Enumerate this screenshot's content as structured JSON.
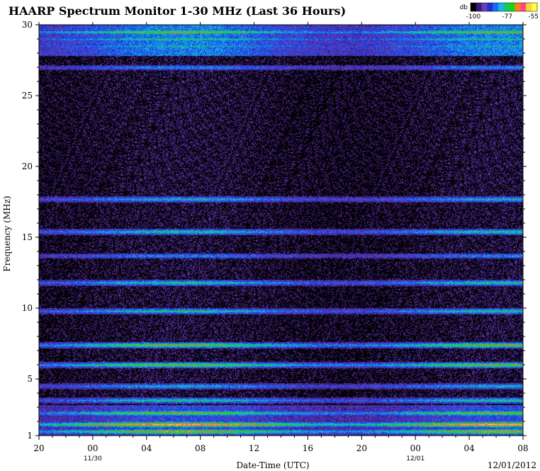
{
  "chart_data": {
    "type": "heatmap",
    "title": "HAARP Spectrum Monitor 1-30 MHz (Last 36 Hours)",
    "xlabel": "Date-Time (UTC)",
    "ylabel": "Frequency (MHz)",
    "date_stamp": "12/01/2012",
    "x_tick_labels": [
      "20",
      "00",
      "04",
      "08",
      "12",
      "16",
      "20",
      "00",
      "04",
      "08"
    ],
    "x_tick_hours": [
      0,
      4,
      8,
      12,
      16,
      20,
      24,
      28,
      32,
      36
    ],
    "date_labels": [
      {
        "label": "11/30",
        "hour": 4
      },
      {
        "label": "12/01",
        "hour": 28
      }
    ],
    "y_tick_labels": [
      "1",
      "5",
      "10",
      "15",
      "20",
      "25",
      "30"
    ],
    "y_tick_values": [
      1,
      5,
      10,
      15,
      20,
      25,
      30
    ],
    "ylim": [
      1,
      30
    ],
    "xlim_hours": [
      0,
      36
    ],
    "colorbar": {
      "label": "db",
      "tick_labels": [
        "-100",
        "-77",
        "-55"
      ],
      "colors": [
        "#000000",
        "#3a1a78",
        "#6a3db4",
        "#2030d0",
        "#1a6cf0",
        "#17b4e8",
        "#12c66a",
        "#19d80a",
        "#ff7a2a",
        "#ff4e7a",
        "#ffd040",
        "#ffff40"
      ]
    },
    "bands": [
      {
        "f": 29.5,
        "level": 0.55
      },
      {
        "f": 29.0,
        "level": 0.45
      },
      {
        "f": 28.5,
        "level": 0.4
      },
      {
        "f": 27.0,
        "level": 0.35
      },
      {
        "f": 17.7,
        "level": 0.4
      },
      {
        "f": 15.4,
        "level": 0.45
      },
      {
        "f": 13.7,
        "level": 0.35
      },
      {
        "f": 11.8,
        "level": 0.45
      },
      {
        "f": 9.8,
        "level": 0.45
      },
      {
        "f": 7.4,
        "level": 0.55
      },
      {
        "f": 6.0,
        "level": 0.55
      },
      {
        "f": 4.5,
        "level": 0.4
      },
      {
        "f": 3.5,
        "level": 0.45
      },
      {
        "f": 2.6,
        "level": 0.55
      },
      {
        "f": 1.8,
        "level": 0.7
      },
      {
        "f": 1.3,
        "level": 0.6
      }
    ]
  }
}
